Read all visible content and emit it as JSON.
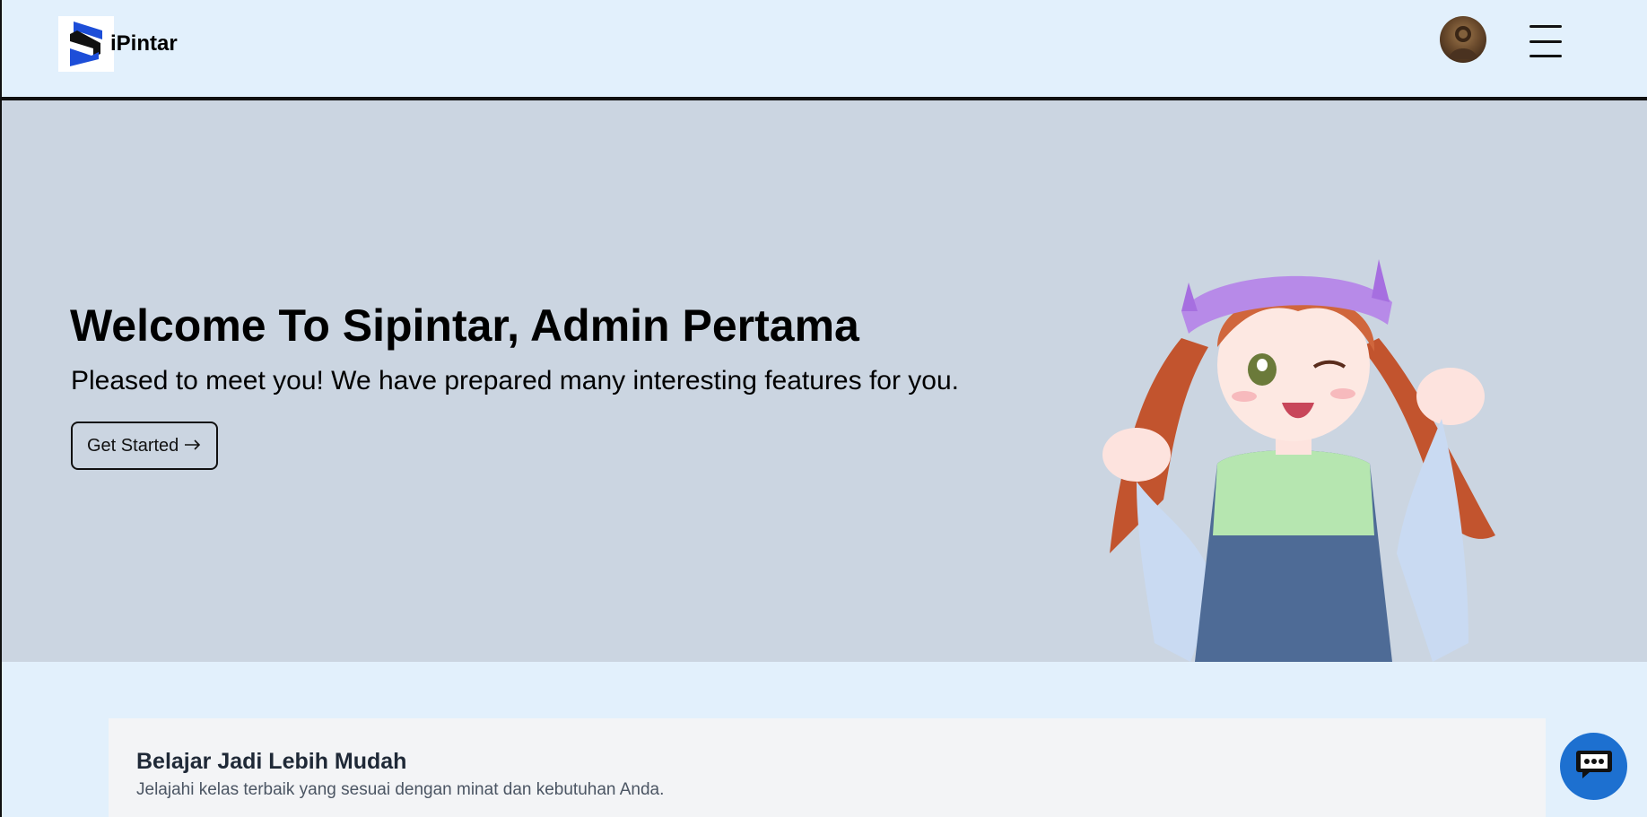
{
  "header": {
    "logo_text": "iPintar",
    "logo_icon": "s-logo-icon",
    "avatar_icon": "user-avatar",
    "menu_icon": "hamburger-menu-icon"
  },
  "hero": {
    "title": "Welcome To Sipintar, Admin Pertama",
    "subtitle": "Pleased to meet you! We have prepared many interesting features for you.",
    "cta_label": "Get Started",
    "cta_icon": "arrow-right-icon",
    "illustration": "anime-girl-illustration"
  },
  "section": {
    "title": "Belajar Jadi Lebih Mudah",
    "subtitle": "Jelajahi kelas terbaik yang sesuai dengan minat dan kebutuhan Anda."
  },
  "chat": {
    "icon": "chat-bubble-icon"
  },
  "colors": {
    "header_bg": "#e2f0fc",
    "hero_bg": "#cbd5e1",
    "accent": "#1d70d0",
    "logo_blue": "#1d4ed8"
  }
}
